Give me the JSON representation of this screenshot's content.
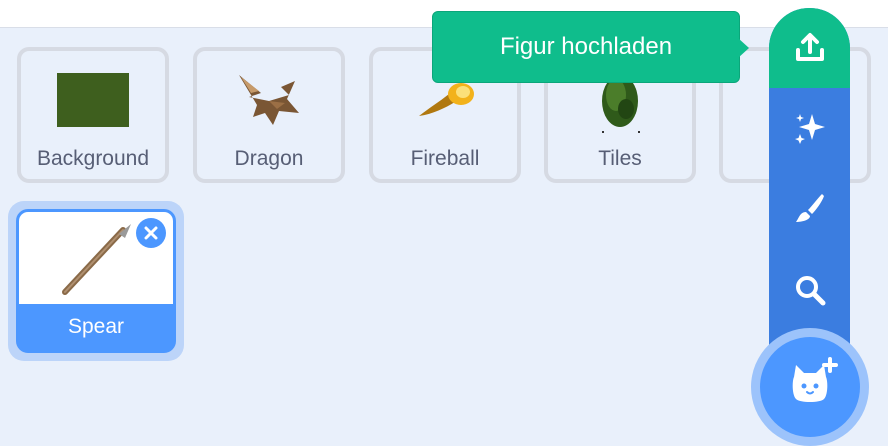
{
  "sprites": [
    {
      "name": "Background",
      "icon": "green-square-thumbnail"
    },
    {
      "name": "Dragon",
      "icon": "dragon-thumbnail"
    },
    {
      "name": "Fireball",
      "icon": "fireball-thumbnail"
    },
    {
      "name": "Tiles",
      "icon": "tree-thumbnail"
    }
  ],
  "selected_sprite": {
    "name": "Spear",
    "icon": "spear-thumbnail"
  },
  "tooltip": {
    "text": "Figur hochladen"
  },
  "menu": {
    "items": [
      "upload-icon",
      "surprise-sparkles-icon",
      "paint-brush-icon",
      "search-icon"
    ],
    "main_button_icon": "cat-plus-icon"
  },
  "colors": {
    "accent_blue": "#4c97ff",
    "rail_blue": "#3b7de0",
    "upload_green": "#0fbd8c",
    "background": "#e9f0fb",
    "label_gray": "#575e75"
  }
}
